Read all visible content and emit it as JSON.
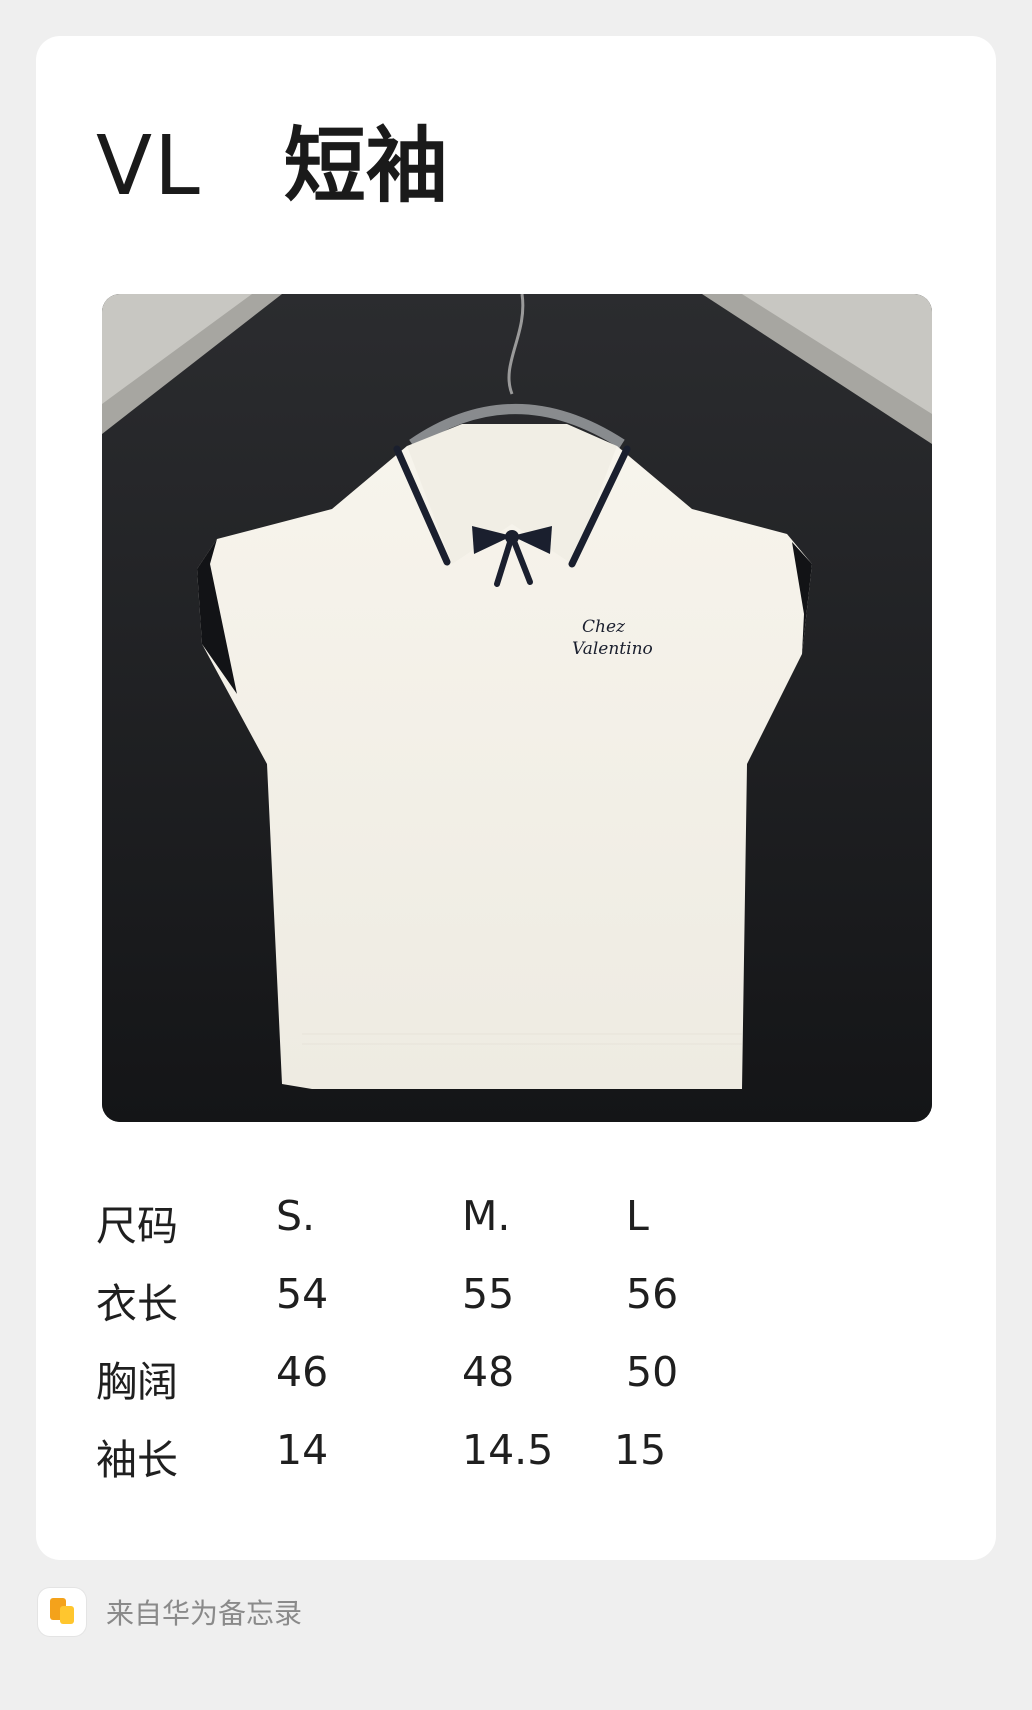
{
  "note": {
    "title_brand": "VL",
    "title_name": "短袖",
    "photo": {
      "description_icon": "garment-photo",
      "embroidery_line1": "Chez",
      "embroidery_line2": "Valentino"
    },
    "size_table": {
      "rows": [
        {
          "label": "尺码",
          "s": "S.",
          "m": "M.",
          "l": "L"
        },
        {
          "label": "衣长",
          "s": "54",
          "m": "55",
          "l": "56"
        },
        {
          "label": "胸阔",
          "s": "46",
          "m": "48",
          "l": "50"
        },
        {
          "label": "袖长",
          "s": "14",
          "m": "14.5",
          "l": "15"
        }
      ]
    }
  },
  "footer": {
    "app_icon": "huawei-notes-icon",
    "source_text": "来自华为备忘录"
  },
  "colors": {
    "background": "#efefef",
    "card": "#ffffff",
    "text": "#1a1a1a",
    "footer_text": "#8a8a8a"
  }
}
